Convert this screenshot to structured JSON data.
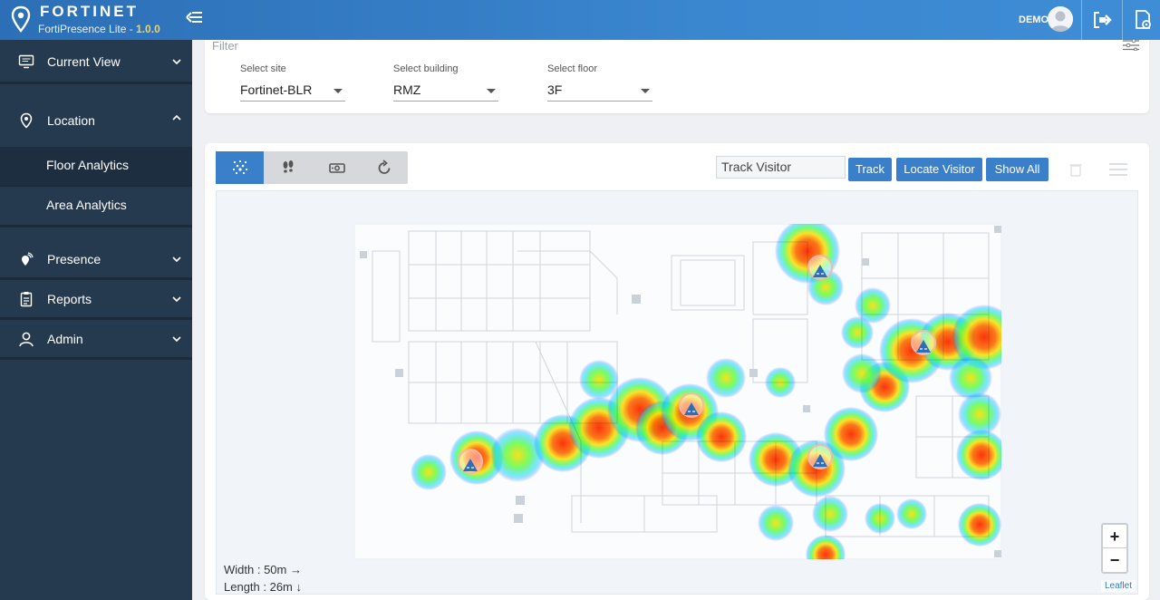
{
  "header": {
    "brand_name": "FORTINET",
    "product": "FortiPresence Lite - ",
    "version": "1.0.0",
    "user": "DEMO",
    "accent": "#3a86cf"
  },
  "sidebar": {
    "items": [
      {
        "label": "Current View",
        "icon": "monitor-icon",
        "expanded": false
      },
      {
        "label": "Location",
        "icon": "location-pin-icon",
        "expanded": true,
        "children": [
          {
            "label": "Floor Analytics",
            "active": true
          },
          {
            "label": "Area Analytics",
            "active": false
          }
        ]
      },
      {
        "label": "Presence",
        "icon": "presence-pin-icon",
        "expanded": false
      },
      {
        "label": "Reports",
        "icon": "clipboard-icon",
        "expanded": false
      },
      {
        "label": "Admin",
        "icon": "user-icon",
        "expanded": false
      }
    ]
  },
  "filter": {
    "title": "Filter",
    "site": {
      "label": "Select site",
      "value": "Fortinet-BLR"
    },
    "building": {
      "label": "Select building",
      "value": "RMZ"
    },
    "floor": {
      "label": "Select floor",
      "value": "3F"
    }
  },
  "map": {
    "modes": [
      "heatmap-icon",
      "footsteps-icon",
      "camera-icon",
      "refresh-icon"
    ],
    "track_placeholder": "Track Visitor",
    "track_label": "Track",
    "locate_label": "Locate Visitor",
    "show_all_label": "Show All",
    "width_text": "Width : 50m →",
    "length_text": "Length : 26m ↓",
    "zoom_in": "+",
    "zoom_out": "−",
    "attribution": "Leaflet"
  }
}
